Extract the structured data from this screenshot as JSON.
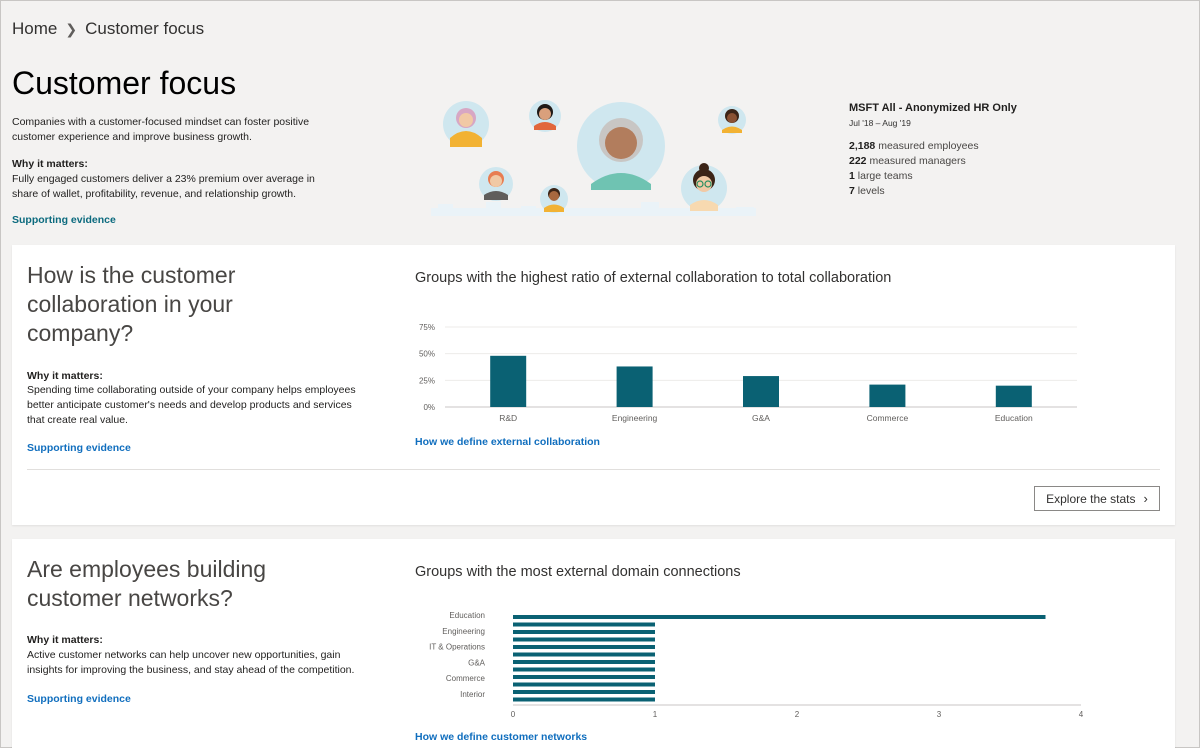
{
  "breadcrumb": {
    "home": "Home",
    "current": "Customer focus"
  },
  "page": {
    "title": "Customer focus",
    "intro": "Companies with a customer-focused mindset can foster positive customer experience and improve business growth.",
    "why_label": "Why it matters:",
    "why_text": "Fully engaged customers deliver a 23% premium over average in share of wallet, profitability, revenue, and relationship growth.",
    "link": "Supporting evidence"
  },
  "stats": {
    "title": "MSFT All - Anonymized HR Only",
    "range": "Jul '18 – Aug '19",
    "rows": [
      {
        "value": "2,188",
        "label": "measured employees"
      },
      {
        "value": "222",
        "label": "measured managers"
      },
      {
        "value": "1",
        "label": "large teams"
      },
      {
        "value": "7",
        "label": "levels"
      }
    ]
  },
  "card1": {
    "heading": "How is the customer collaboration in your company?",
    "why_label": "Why it matters:",
    "why_text": "Spending time collaborating outside of your company helps employees better anticipate customer's needs and develop products and services that create real value.",
    "link": "Supporting evidence",
    "chart_title": "Groups with the highest ratio of external collaboration to total collaboration",
    "chart_link": "How we define external collaboration",
    "button": "Explore the stats"
  },
  "card2": {
    "heading": "Are employees building customer networks?",
    "why_label": "Why it matters:",
    "why_text": "Active customer networks can help uncover new opportunities, gain insights for improving the business, and stay ahead of the competition.",
    "link": "Supporting evidence",
    "chart_title": "Groups with the most external domain connections",
    "chart_link": "How we define customer networks"
  },
  "colors": {
    "bar": "#0a6173",
    "link": "#106ebe",
    "accent_link": "#0b6a7e"
  },
  "chart_data": [
    {
      "type": "bar",
      "categories": [
        "R&D",
        "Engineering",
        "G&A",
        "Commerce",
        "Education"
      ],
      "values": [
        48,
        38,
        29,
        21,
        20
      ],
      "ylim": [
        0,
        75
      ],
      "yticks": [
        "0%",
        "25%",
        "50%",
        "75%"
      ],
      "grid": true
    },
    {
      "type": "bar",
      "orientation": "horizontal",
      "categories": [
        "Education",
        "Engineering",
        "IT & Operations",
        "G&A",
        "Commerce",
        "Interior"
      ],
      "values": [
        3.75,
        1,
        1,
        1,
        1,
        1
      ],
      "xlim": [
        0,
        4
      ],
      "xticks": [
        "0",
        "1",
        "2",
        "3",
        "4"
      ],
      "grid": true
    }
  ]
}
